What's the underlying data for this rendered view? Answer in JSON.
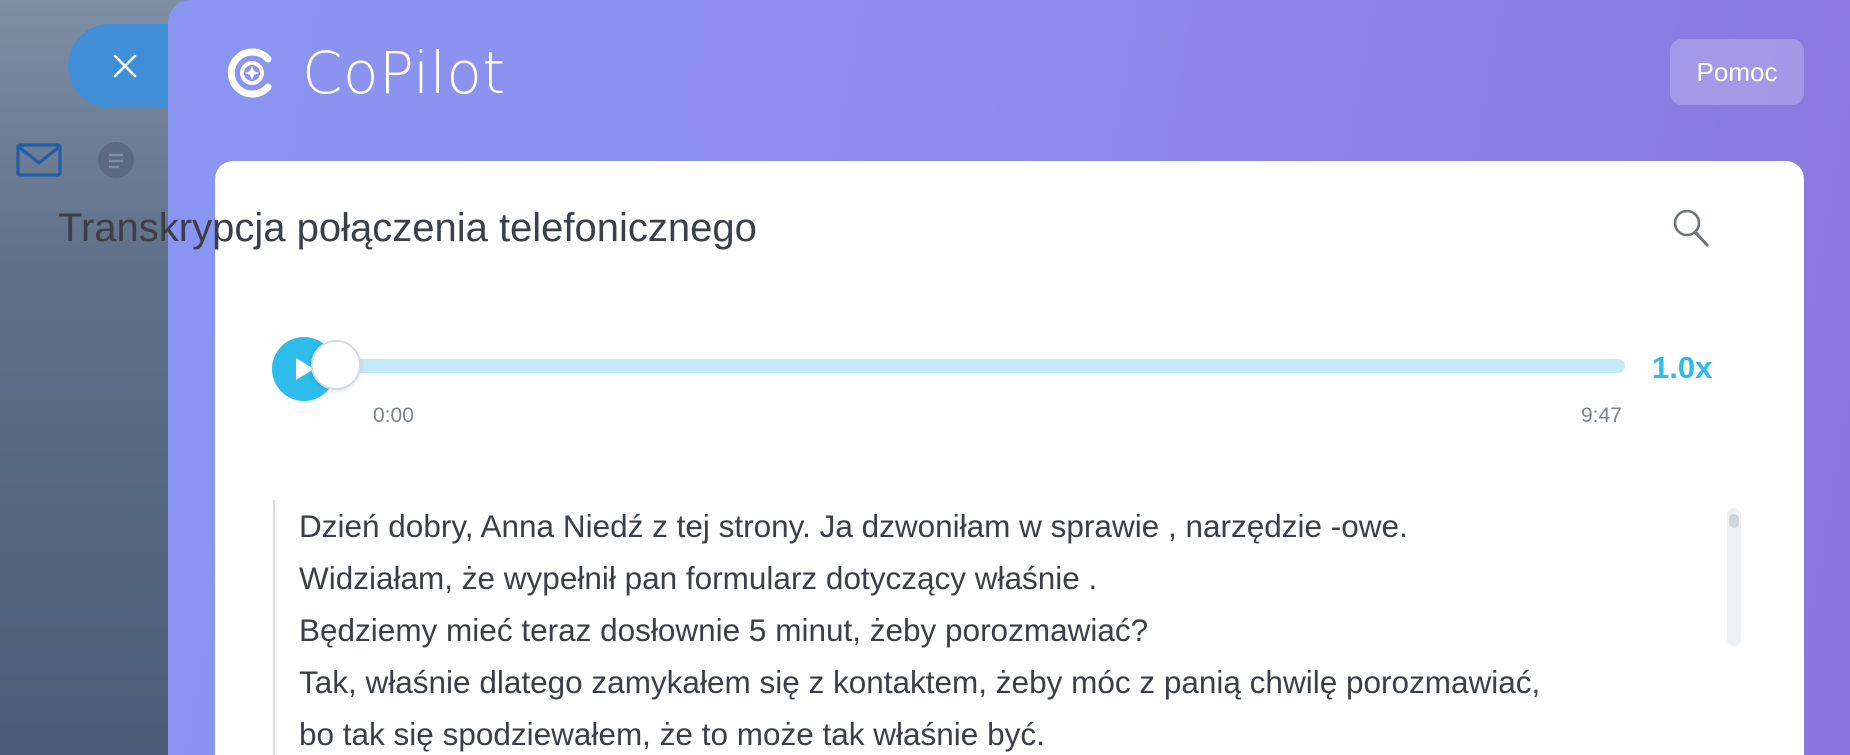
{
  "app": {
    "name": "CoPilot",
    "help_label": "Pomoc"
  },
  "card": {
    "title": "Transkrypcja połączenia telefonicznego"
  },
  "player": {
    "current_time": "0:00",
    "duration": "9:47",
    "speed": "1.0x",
    "progress": 0
  },
  "transcript": {
    "lines": [
      "Dzień dobry, Anna Niedź z tej strony. Ja dzwoniłam w sprawie       , narzędzie        -owe.",
      "Widziałam, że wypełnił pan formularz dotyczący właśnie      .",
      "Będziemy mieć teraz dosłownie 5 minut, żeby porozmawiać?",
      "Tak, właśnie dlatego zamykałem się z kontaktem, żeby móc z panią chwilę porozmawiać,",
      "bo tak się spodziewałem, że to może tak właśnie być."
    ]
  },
  "icons": {
    "close": "close-icon",
    "mail": "mail-icon",
    "chat": "chat-icon",
    "logo": "copilot-logo-icon",
    "search": "search-icon",
    "play": "play-icon"
  },
  "colors": {
    "accent": "#2ebcea",
    "track": "#c4ebfb",
    "panel_start": "#8a95f2",
    "panel_end": "#8a76dd",
    "close_button": "#3f8ed6",
    "text": "#3b3f47"
  }
}
